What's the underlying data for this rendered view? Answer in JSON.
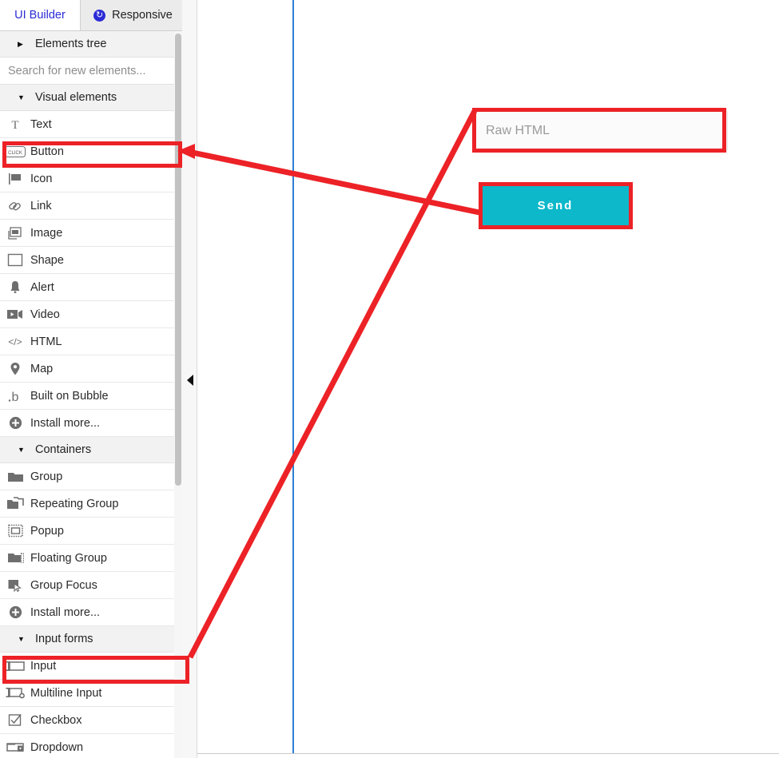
{
  "tabs": [
    {
      "label": "UI Builder",
      "active": true,
      "icon": ""
    },
    {
      "label": "Responsive",
      "active": false,
      "icon": "refresh-circle-icon"
    }
  ],
  "sidebar": {
    "elements_tree": {
      "label": "Elements tree",
      "caret": "▶"
    },
    "search": {
      "placeholder": "Search for new elements..."
    },
    "sections": [
      {
        "label": "Visual elements",
        "caret": "▼",
        "items": [
          {
            "label": "Text",
            "icon": "text-icon",
            "glyph": "T"
          },
          {
            "label": "Button",
            "icon": "button-icon",
            "glyph": "CLICK"
          },
          {
            "label": "Icon",
            "icon": "flag-icon",
            "glyph": "⚑"
          },
          {
            "label": "Link",
            "icon": "link-icon",
            "glyph": "ὑ7"
          },
          {
            "label": "Image",
            "icon": "image-icon",
            "glyph": "IMG"
          },
          {
            "label": "Shape",
            "icon": "shape-icon",
            "glyph": "□"
          },
          {
            "label": "Alert",
            "icon": "bell-icon",
            "glyph": "ὑ4"
          },
          {
            "label": "Video",
            "icon": "video-camera-icon",
            "glyph": "▶"
          },
          {
            "label": "HTML",
            "icon": "code-icon",
            "glyph": "</>"
          },
          {
            "label": "Map",
            "icon": "map-pin-icon",
            "glyph": "ὌD"
          },
          {
            "label": "Built on Bubble",
            "icon": "bubble-logo-icon",
            "glyph": "b"
          },
          {
            "label": "Install more...",
            "icon": "plus-circle-icon",
            "glyph": "⊕"
          }
        ]
      },
      {
        "label": "Containers",
        "caret": "▼",
        "items": [
          {
            "label": "Group",
            "icon": "folder-icon",
            "glyph": "Ὄ1"
          },
          {
            "label": "Repeating Group",
            "icon": "repeating-group-icon",
            "glyph": "὜2"
          },
          {
            "label": "Popup",
            "icon": "popup-icon",
            "glyph": "▣"
          },
          {
            "label": "Floating Group",
            "icon": "floating-group-icon",
            "glyph": "ὛF"
          },
          {
            "label": "Group Focus",
            "icon": "group-focus-icon",
            "glyph": "◱"
          },
          {
            "label": "Install more...",
            "icon": "plus-circle-icon",
            "glyph": "⊕"
          }
        ]
      },
      {
        "label": "Input forms",
        "caret": "▼",
        "items": [
          {
            "label": "Input",
            "icon": "input-icon",
            "glyph": "▭"
          },
          {
            "label": "Multiline Input",
            "icon": "multiline-input-icon",
            "glyph": "▤"
          },
          {
            "label": "Checkbox",
            "icon": "checkbox-icon",
            "glyph": "☑"
          },
          {
            "label": "Dropdown",
            "icon": "dropdown-icon",
            "glyph": "▾"
          }
        ]
      }
    ]
  },
  "canvas": {
    "raw_html_input": {
      "placeholder": "Raw HTML",
      "value": ""
    },
    "send_button": {
      "label": "Send",
      "color": "#0cb8ca"
    }
  },
  "annotations": {
    "highlight_color": "#ec2227",
    "highlights": [
      {
        "name": "button-element-highlight"
      },
      {
        "name": "input-element-highlight"
      },
      {
        "name": "raw-html-input-highlight"
      },
      {
        "name": "send-button-highlight"
      }
    ]
  }
}
